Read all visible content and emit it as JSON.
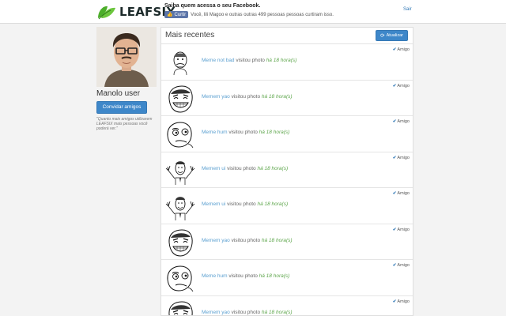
{
  "header": {
    "brand": "LEAFSIX",
    "promo_title": "Saiba quem acessa o seu Facebook.",
    "like_label": "Curtir",
    "promo_text": "Você, lili Magoo e outras outras 499 pessoas pessoas curtiram isso.",
    "logout_label": "Sair",
    "brand_color": "#4cae2a"
  },
  "profile": {
    "name": "Manolo user",
    "invite_label": "Convidar amigos",
    "hint": "\"Quanto mais amigos utilizarem LEAFSIX mais pessoas você poderá ver.\""
  },
  "feed": {
    "title": "Mais recentes",
    "refresh_label": "Atualizar",
    "friend_label": "Amigo",
    "verb": "visitou photo",
    "items": [
      {
        "name": "Meme not bad",
        "verb": "visitou photo",
        "time": "há 18 hora(s)",
        "badge": "Amigo",
        "icon": "obama-not-bad-meme"
      },
      {
        "name": "Memem yao",
        "verb": "visitou photo",
        "time": "há 18 hora(s)",
        "badge": "Amigo",
        "icon": "yao-ming-meme"
      },
      {
        "name": "Meme hum",
        "verb": "visitou photo",
        "time": "há 18 hora(s)",
        "badge": "Amigo",
        "icon": "hmm-meme"
      },
      {
        "name": "Memem ui",
        "verb": "visitou photo",
        "time": "há 18 hora(s)",
        "badge": "Amigo",
        "icon": "yeah-meme"
      },
      {
        "name": "Memem ui",
        "verb": "visitou photo",
        "time": "há 18 hora(s)",
        "badge": "Amigo",
        "icon": "yeah-meme"
      },
      {
        "name": "Memem yao",
        "verb": "visitou photo",
        "time": "há 18 hora(s)",
        "badge": "Amigo",
        "icon": "yao-ming-meme"
      },
      {
        "name": "Meme hum",
        "verb": "visitou photo",
        "time": "há 18 hora(s)",
        "badge": "Amigo",
        "icon": "hmm-meme"
      },
      {
        "name": "Memem yao",
        "verb": "visitou photo",
        "time": "há 18 hora(s)",
        "badge": "Amigo",
        "icon": "yao-ming-meme"
      }
    ]
  }
}
